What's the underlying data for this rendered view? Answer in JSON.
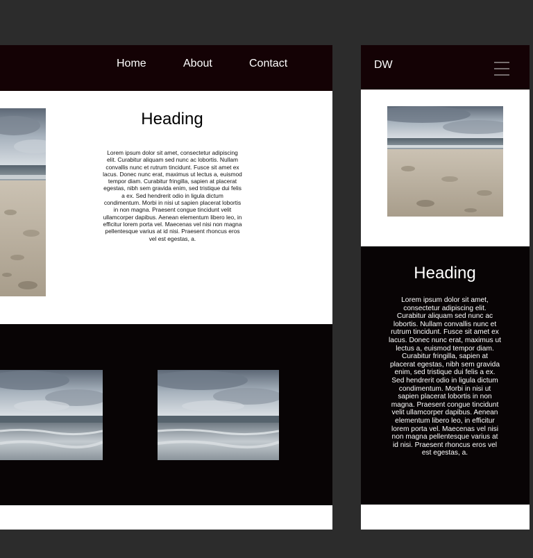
{
  "desktop": {
    "nav": {
      "items": [
        {
          "label": "Home"
        },
        {
          "label": "About"
        },
        {
          "label": "Contact"
        }
      ]
    },
    "hero": {
      "heading": "Heading",
      "body": "Lorem ipsum dolor sit amet, consectetur adipiscing elit. Curabitur aliquam sed nunc ac lobortis. Nullam convallis nunc et rutrum tincidunt. Fusce sit amet ex lacus. Donec nunc erat, maximus ut lectus a, euismod tempor diam. Curabitur fringilla, sapien at placerat egestas, nibh sem gravida enim, sed tristique dui felis a ex. Sed hendrerit odio in ligula dictum condimentum. Morbi in nisi ut sapien placerat lobortis in non magna. Praesent congue tincidunt velit ullamcorper dapibus. Aenean elementum libero leo, in efficitur lorem porta vel. Maecenas vel nisi non magna pellentesque varius at id nisi. Praesent rhoncus eros vel est egestas, a."
    }
  },
  "mobile": {
    "logo": "DW",
    "heading": "Heading",
    "body": "Lorem ipsum dolor sit amet, consectetur adipiscing elit. Curabitur aliquam sed nunc ac lobortis. Nullam convallis nunc et rutrum tincidunt. Fusce sit amet ex lacus. Donec nunc erat, maximus ut lectus a, euismod tempor diam. Curabitur fringilla, sapien at placerat egestas, nibh sem gravida enim, sed tristique dui felis a ex. Sed hendrerit odio in ligula dictum condimentum. Morbi in nisi ut sapien placerat lobortis in non magna. Praesent congue tincidunt velit ullamcorper dapibus. Aenean elementum libero leo, in efficitur lorem porta vel. Maecenas vel nisi non magna pellentesque varius at id nisi. Praesent rhoncus eros vel est egestas, a."
  },
  "icons": {
    "menu": "hamburger-menu-icon"
  },
  "colors": {
    "canvas": "#2c2c2c",
    "nav": "#140205",
    "dark_section": "#080405",
    "page": "#ffffff"
  }
}
